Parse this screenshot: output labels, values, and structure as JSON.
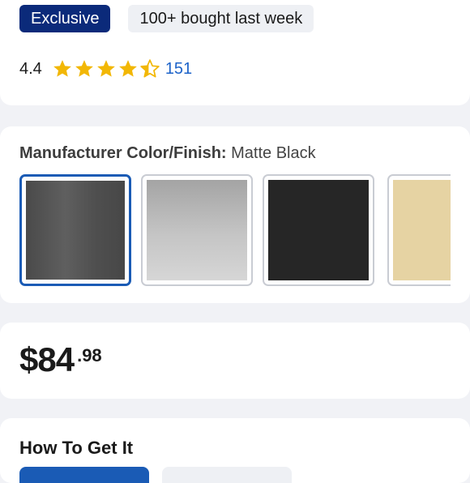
{
  "badges": {
    "exclusive": "Exclusive",
    "bought": "100+ bought last week"
  },
  "rating": {
    "value": "4.4",
    "stars_filled": 4.4,
    "count": "151",
    "star_color": "#f2b705"
  },
  "color": {
    "label": "Manufacturer Color/Finish:",
    "selected": "Matte Black",
    "swatches": [
      "Matte Black",
      "Brushed Nickel",
      "Black",
      "Champagne Bronze"
    ]
  },
  "price": {
    "dollars": "$84",
    "cents": ".98"
  },
  "get_it": {
    "title": "How To Get It"
  },
  "colors": {
    "accent": "#1a5bb5",
    "badge": "#0b2a7a",
    "link": "#1d63c9"
  }
}
